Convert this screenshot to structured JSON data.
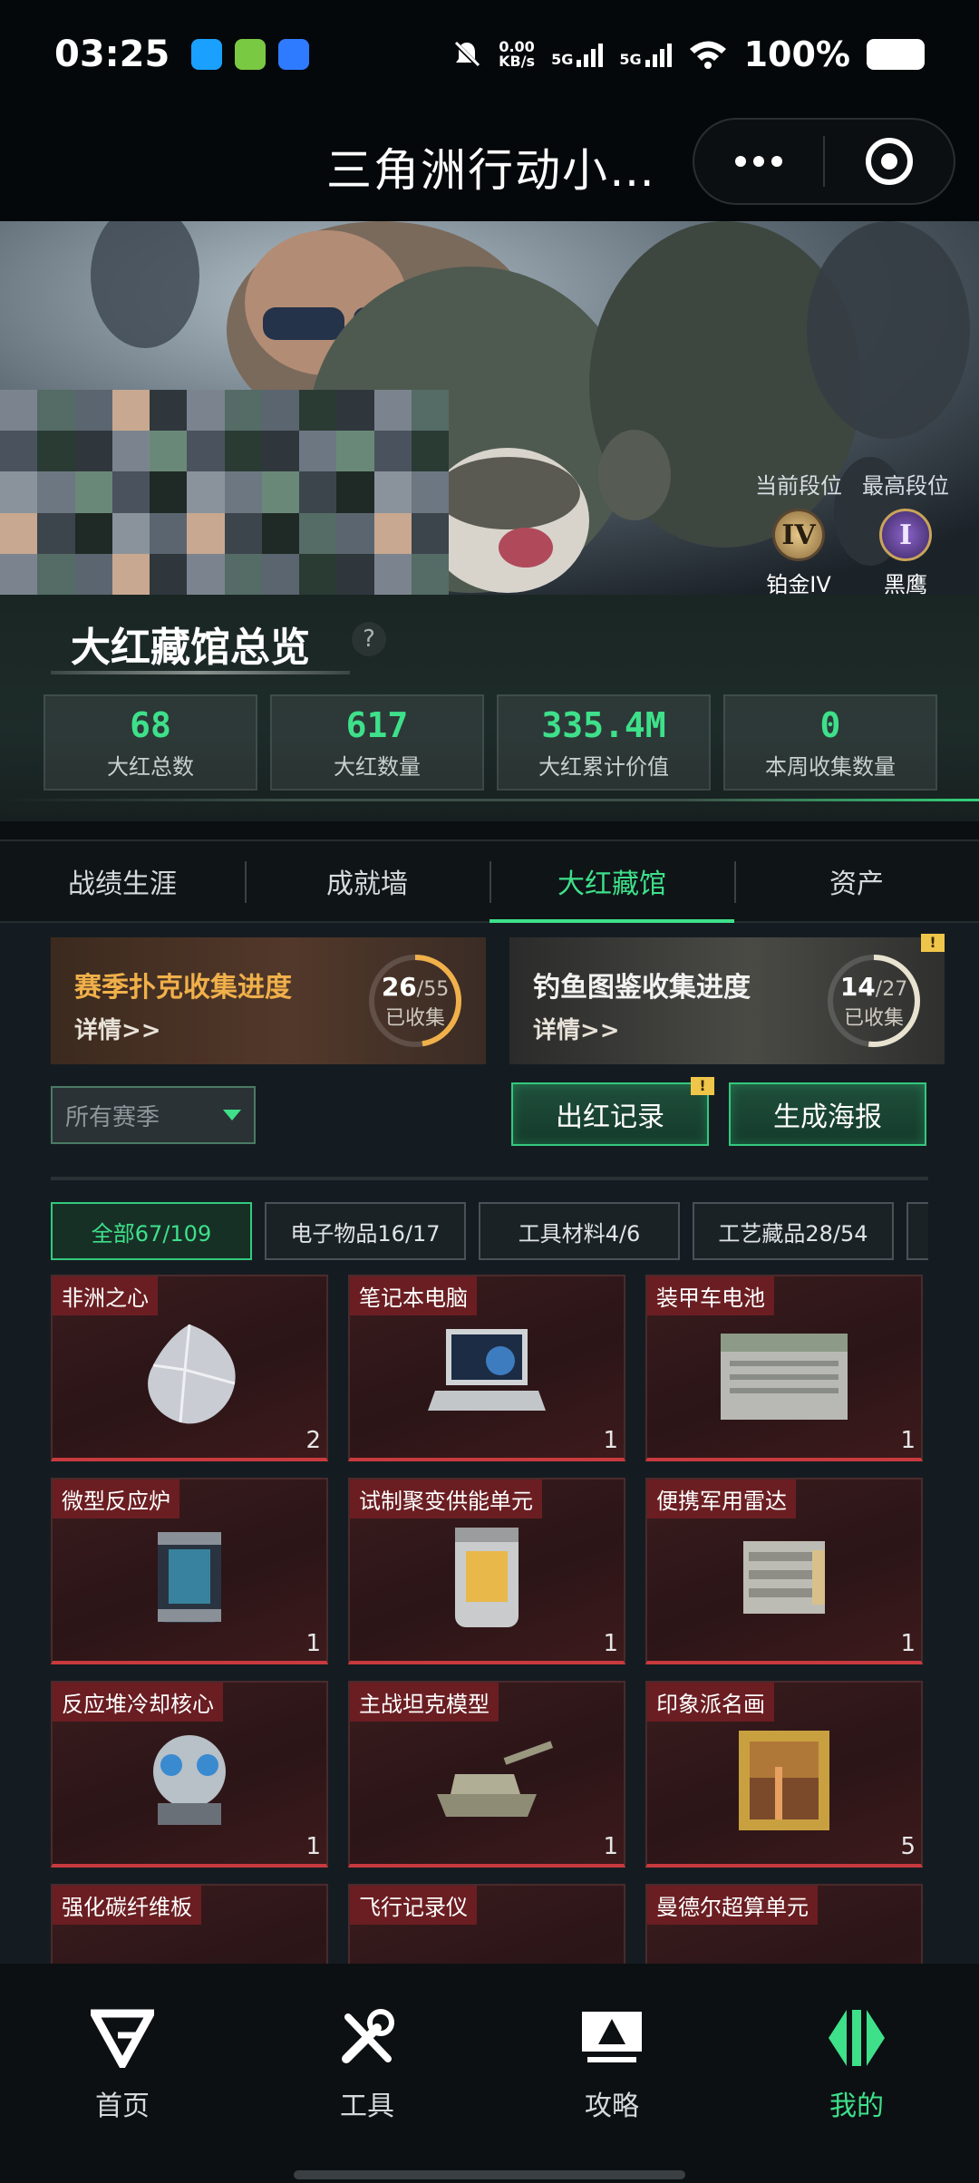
{
  "status": {
    "time": "03:25",
    "net_speed": "0.00",
    "net_unit": "KB/s",
    "net1": "5G",
    "net2": "5G",
    "battery": "100%"
  },
  "titlebar": {
    "title": "三角洲行动小…"
  },
  "profile": {
    "current_rank_label": "当前段位",
    "highest_rank_label": "最高段位",
    "current_rank_badge": "IV",
    "current_rank": "铂金IV",
    "highest_rank_badge": "I",
    "highest_rank": "黑鹰"
  },
  "overview": {
    "title": "大红藏馆总览",
    "help": "?",
    "stats": [
      {
        "value": "68",
        "label": "大红总数"
      },
      {
        "value": "617",
        "label": "大红数量"
      },
      {
        "value": "335.4M",
        "label": "大红累计价值"
      },
      {
        "value": "0",
        "label": "本周收集数量"
      }
    ]
  },
  "tabs": [
    {
      "label": "战绩生涯"
    },
    {
      "label": "成就墙"
    },
    {
      "label": "大红藏馆"
    },
    {
      "label": "资产"
    }
  ],
  "progress_cards": [
    {
      "title": "赛季扑克收集进度",
      "detail": "详情>>",
      "current": "26",
      "total": "/55",
      "status": "已收集",
      "fraction": 0.4727
    },
    {
      "title": "钓鱼图鉴收集进度",
      "detail": "详情>>",
      "current": "14",
      "total": "/27",
      "status": "已收集",
      "fraction": 0.5185,
      "notice": "!"
    }
  ],
  "filters": {
    "season_value": "所有赛季",
    "red_record": "出红记录",
    "red_record_notice": "!",
    "poster": "生成海报"
  },
  "categories": [
    {
      "label": "全部67/109"
    },
    {
      "label": "电子物品16/17"
    },
    {
      "label": "工具材料4/6"
    },
    {
      "label": "工艺藏品28/54"
    }
  ],
  "items": [
    {
      "name": "非洲之心",
      "count": "2"
    },
    {
      "name": "笔记本电脑",
      "count": "1"
    },
    {
      "name": "装甲车电池",
      "count": "1"
    },
    {
      "name": "微型反应炉",
      "count": "1"
    },
    {
      "name": "试制聚变供能单元",
      "count": "1"
    },
    {
      "name": "便携军用雷达",
      "count": "1"
    },
    {
      "name": "反应堆冷却核心",
      "count": "1"
    },
    {
      "name": "主战坦克模型",
      "count": "1"
    },
    {
      "name": "印象派名画",
      "count": "5"
    },
    {
      "name": "强化碳纤维板",
      "count": ""
    },
    {
      "name": "飞行记录仪",
      "count": ""
    },
    {
      "name": "曼德尔超算单元",
      "count": ""
    }
  ],
  "bottom_nav": [
    {
      "label": "首页",
      "icon": "delta-logo-icon"
    },
    {
      "label": "工具",
      "icon": "tools-icon"
    },
    {
      "label": "攻略",
      "icon": "guide-monitor-icon"
    },
    {
      "label": "我的",
      "icon": "profile-logo-icon"
    }
  ],
  "colors": {
    "accent": "#3ee08a",
    "red_item": "#c83a3e",
    "gold": "#f0b04a"
  }
}
